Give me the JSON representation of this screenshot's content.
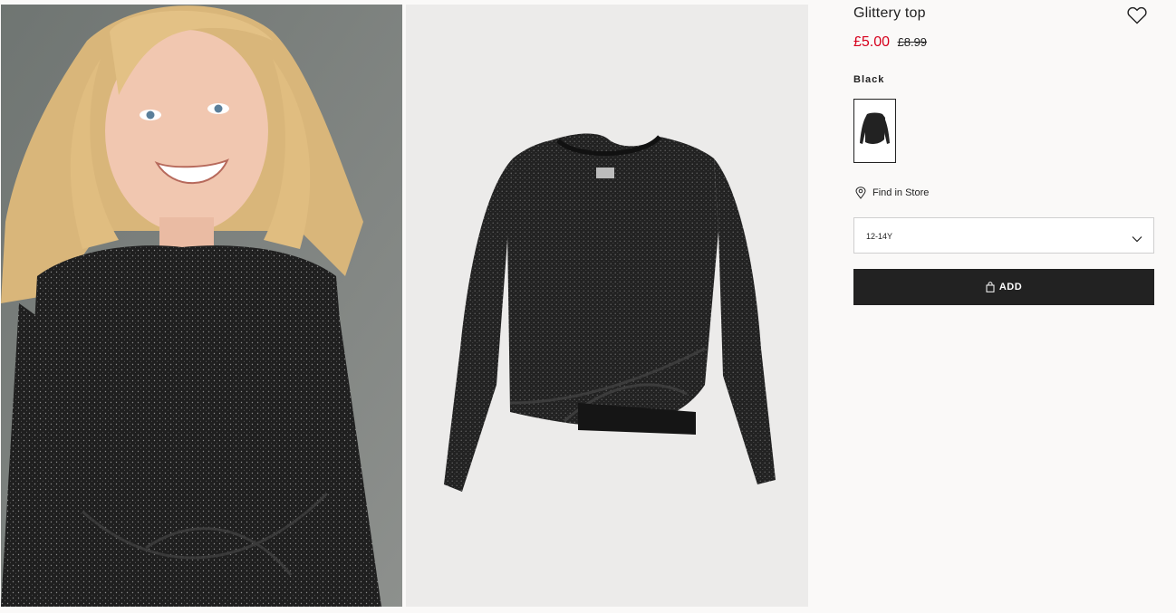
{
  "product": {
    "title": "Glittery top",
    "sale_price": "£5.00",
    "original_price": "£8.99",
    "color_name": "Black",
    "find_in_store_label": "Find in Store",
    "selected_size": "12-14Y",
    "add_button_label": "ADD"
  },
  "colors": {
    "sale": "#d6001c",
    "button_bg": "#222222",
    "panel_bg": "#faf9f8"
  },
  "icons": {
    "favourite": "heart-icon",
    "location": "map-pin-icon",
    "dropdown": "chevron-down-icon",
    "bag": "shopping-bag-icon"
  }
}
